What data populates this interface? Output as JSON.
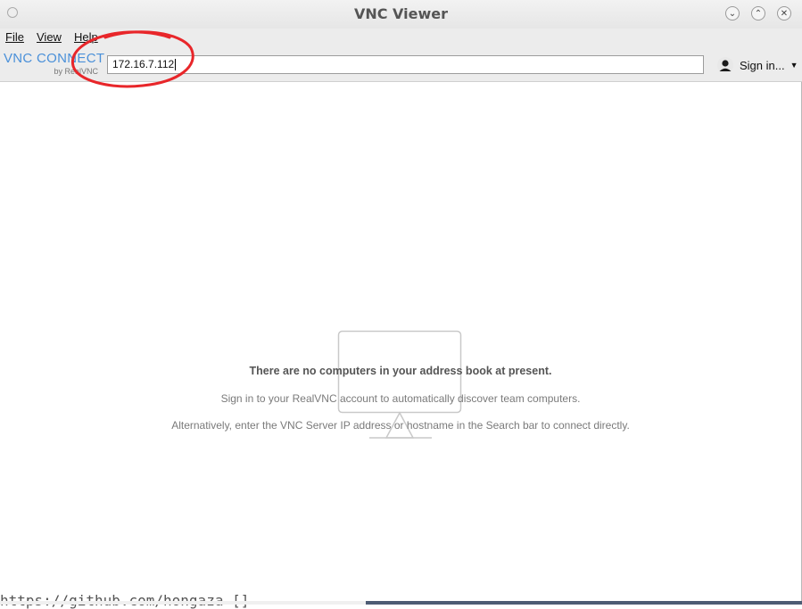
{
  "window": {
    "title": "VNC Viewer"
  },
  "menu": {
    "file": "File",
    "view": "View",
    "help": "Help"
  },
  "logo": {
    "main": "VNC CONNECT",
    "sub": "by RealVNC"
  },
  "address_bar": {
    "value": "172.16.7.112"
  },
  "signin": {
    "label": "Sign in..."
  },
  "empty_state": {
    "heading": "There are no computers in your address book at present.",
    "line1": "Sign in to your RealVNC account to automatically discover team computers.",
    "line2": "Alternatively, enter the VNC Server IP address or hostname in the Search bar to connect directly."
  },
  "background_terminal": {
    "text": "https://github.com/hongaza   []"
  },
  "colors": {
    "accent": "#4a90d9",
    "annotation": "#e8262a"
  },
  "icons": [
    "window-menu-icon",
    "minimize-icon",
    "maximize-icon",
    "close-icon",
    "user-avatar-icon",
    "dropdown-caret-icon",
    "monitor-icon"
  ]
}
